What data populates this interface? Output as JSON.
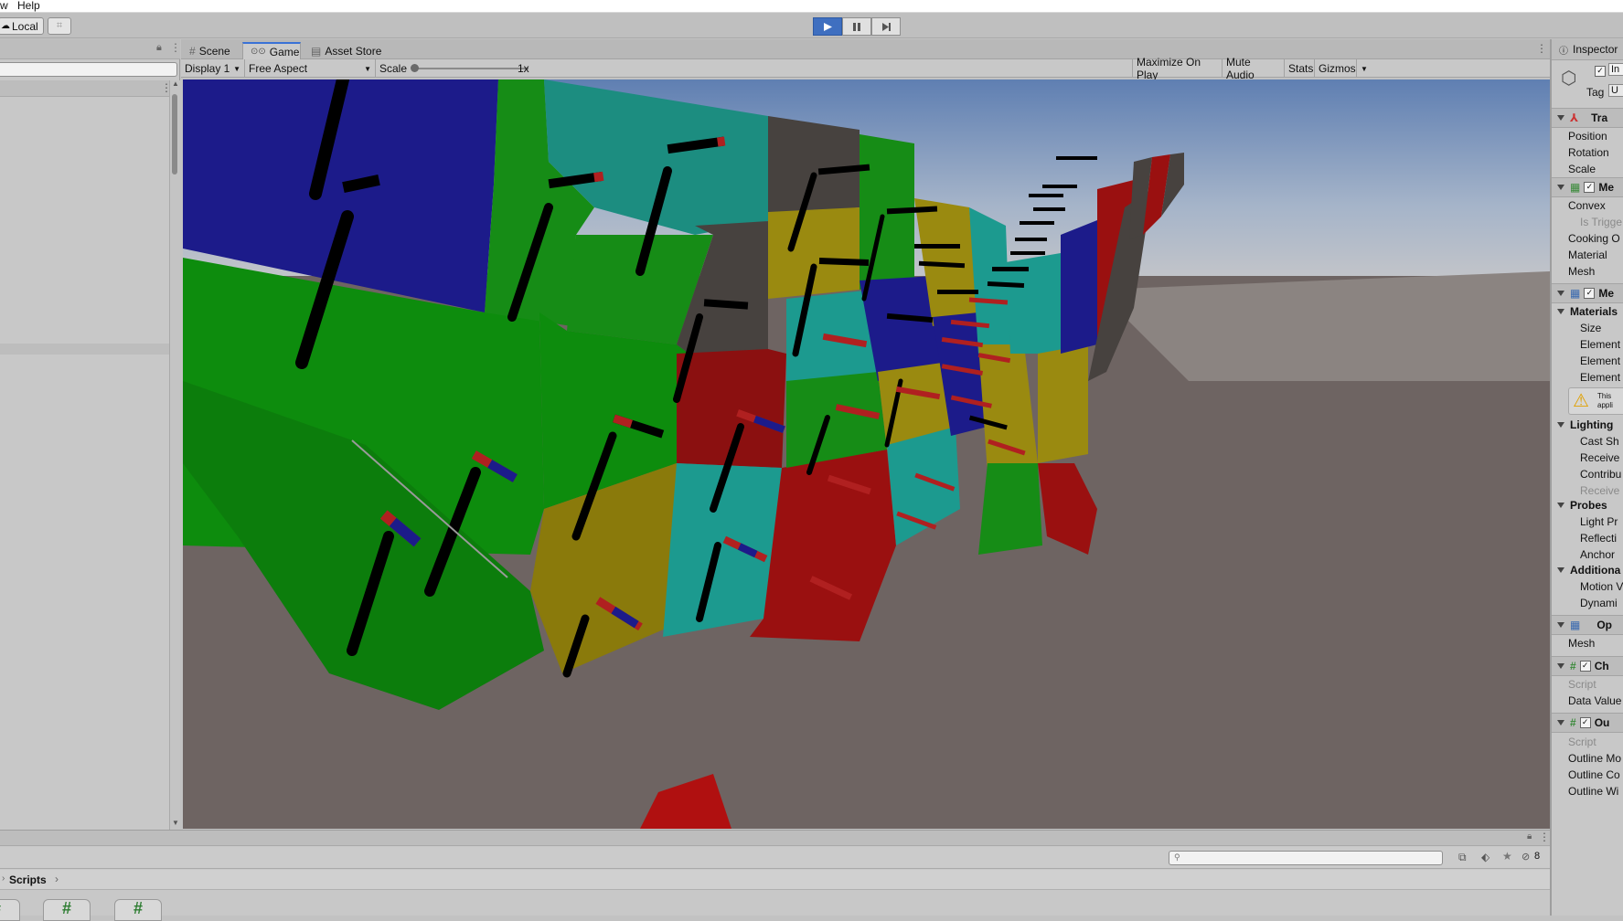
{
  "menubar": {
    "items": [
      "w",
      "Help"
    ]
  },
  "toolbar": {
    "layer_button": "Local",
    "play_icon": "play-icon",
    "pause_icon": "pause-icon",
    "step_icon": "step-icon"
  },
  "colors": {
    "accent": "#3f6fc0",
    "tab_highlight": "#3a72d6",
    "sky": "#6f8fbb",
    "ground": "#6e6462"
  },
  "game_tabs": [
    {
      "label": "Scene",
      "icon": "hash-icon"
    },
    {
      "label": "Game",
      "icon": "gamepad-icon",
      "active": true
    },
    {
      "label": "Asset Store",
      "icon": "bag-icon"
    }
  ],
  "game_bar": {
    "display": "Display 1",
    "aspect": "Free Aspect",
    "scale_label": "Scale",
    "scale_value": "1x",
    "maximize": "Maximize On Play",
    "mute": "Mute Audio",
    "stats": "Stats",
    "gizmos": "Gizmos"
  },
  "project": {
    "breadcrumb": "Scripts",
    "hidden_count": "8",
    "assets": [
      "#",
      "#",
      "#"
    ]
  },
  "inspector": {
    "title": "Inspector",
    "tag_label": "Tag",
    "tag_value": "U",
    "name_value": "In",
    "transform": {
      "title": "Tra",
      "rows": [
        "Position",
        "Rotation",
        "Scale"
      ]
    },
    "mesh_collider": {
      "title": "Me",
      "rows": [
        "Convex",
        "Is Trigge",
        "Cooking O",
        "Material",
        "Mesh"
      ]
    },
    "mesh_renderer": {
      "title": "Me"
    },
    "materials": {
      "title": "Materials",
      "rows": [
        "Size",
        "Element",
        "Element",
        "Element"
      ]
    },
    "warning": {
      "line1": "This",
      "line2": "appli"
    },
    "lighting": {
      "title": "Lighting",
      "rows": [
        "Cast Sh",
        "Receive",
        "Contribu",
        "Receive"
      ]
    },
    "probes": {
      "title": "Probes",
      "rows": [
        "Light Pr",
        "Reflecti",
        "Anchor"
      ]
    },
    "additional": {
      "title": "Additiona",
      "rows": [
        "Motion V",
        "Dynami"
      ]
    },
    "outline_mesh": {
      "title": "Op",
      "rows": [
        "Mesh"
      ]
    },
    "chart_script": {
      "title": "Ch",
      "rows": [
        "Script",
        "Data Value"
      ]
    },
    "outline_script": {
      "title": "Ou",
      "rows": [
        "Script",
        "Outline Mo",
        "Outline Co",
        "Outline Wi"
      ]
    }
  }
}
